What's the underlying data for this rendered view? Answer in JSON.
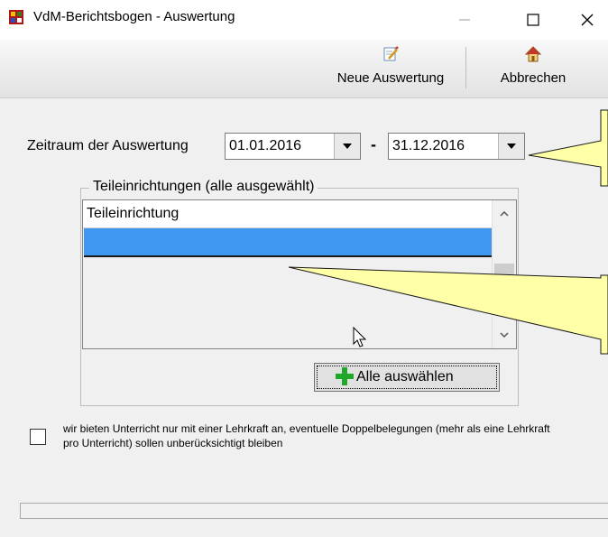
{
  "window": {
    "title": "VdM-Berichtsbogen - Auswertung",
    "controls": {
      "minimize": "—",
      "maximize": "☐",
      "close": "✕"
    }
  },
  "toolbar": {
    "neue_label": "Neue Auswertung",
    "neue_icon": "edit-document-icon",
    "abbrechen_label": "Abbrechen",
    "abbrechen_icon": "home-icon"
  },
  "zeitraum": {
    "label": "Zeitraum der Auswertung",
    "from": "01.01.2016",
    "separator": "-",
    "to": "31.12.2016"
  },
  "teileinrichtungen": {
    "legend": "Teileinrichtungen (alle ausgewählt)",
    "column_header": "Teileinrichtung",
    "rows": [
      ""
    ],
    "select_all_label": "Alle auswählen"
  },
  "option": {
    "checked": false,
    "text": "wir bieten Unterricht nur mit einer Lehrkraft an, eventuelle Doppelbelegungen (mehr als eine Lehrkraft pro Unterricht) sollen unberücksichtigt bleiben"
  },
  "colors": {
    "selection": "#3f97f2",
    "callout": "#ffffa8",
    "plus_icon": "#1fa82a"
  }
}
